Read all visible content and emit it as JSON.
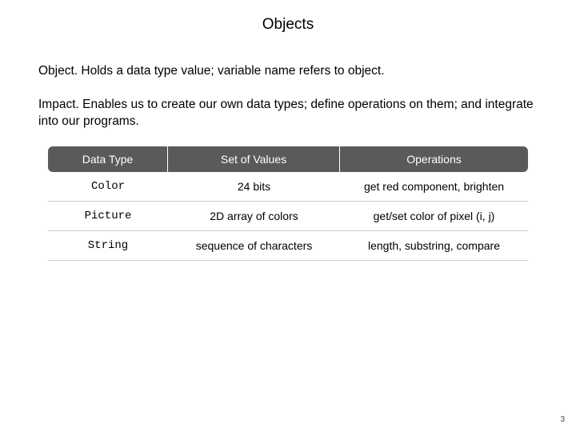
{
  "title": "Objects",
  "para1": {
    "lead": "Object.",
    "rest": "  Holds a data type value; variable name refers to object."
  },
  "para2": {
    "lead": "Impact.",
    "rest": "  Enables us to create our own data types; define operations on them; and integrate into our programs."
  },
  "table": {
    "headers": [
      "Data Type",
      "Set of Values",
      "Operations"
    ],
    "rows": [
      {
        "dt": "Color",
        "sv": "24 bits",
        "op": "get red component, brighten"
      },
      {
        "dt": "Picture",
        "sv": "2D array of colors",
        "op": "get/set color of pixel (i, j)"
      },
      {
        "dt": "String",
        "sv": "sequence of characters",
        "op": "length, substring, compare"
      }
    ]
  },
  "pageNumber": "3"
}
